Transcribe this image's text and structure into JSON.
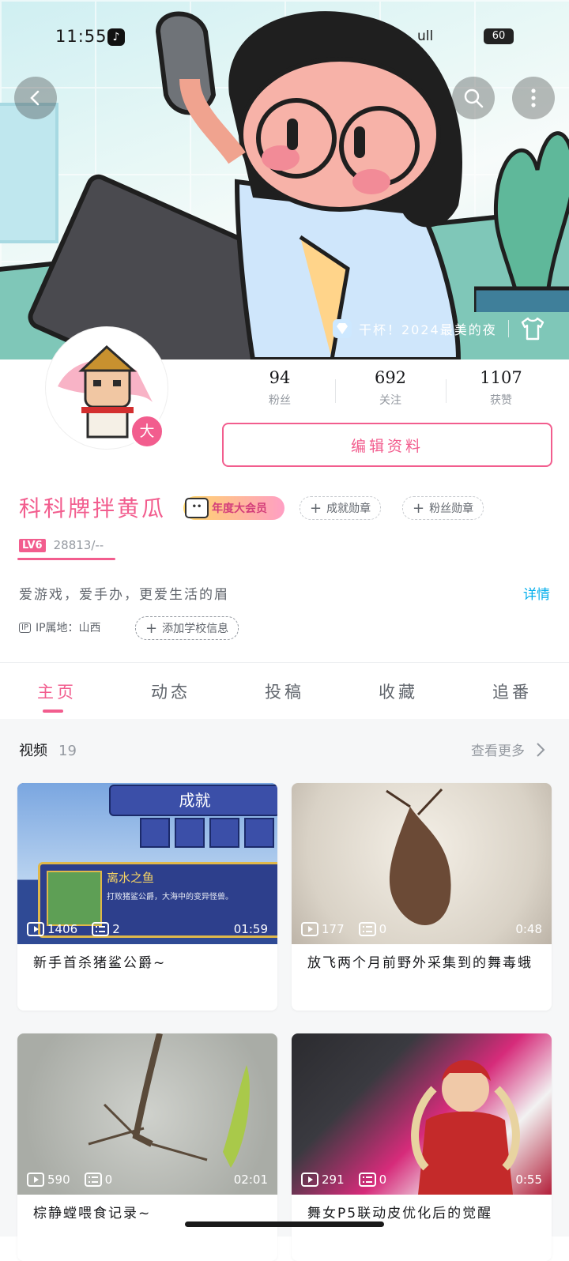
{
  "status_bar": {
    "time": "11:55",
    "signal": "ull",
    "battery": "60"
  },
  "banner": {
    "suit_label": "干杯！2024最美的夜"
  },
  "profile": {
    "avatar_badge": "大",
    "stats": [
      {
        "value": "94",
        "label": "粉丝"
      },
      {
        "value": "692",
        "label": "关注"
      },
      {
        "value": "1107",
        "label": "获赞"
      }
    ],
    "edit_label": "编辑资料",
    "name": "科科牌拌黄瓜",
    "vip_label": "年度大会员",
    "medal_achievement": "成就勋章",
    "medal_fans": "粉丝勋章",
    "level": "LV6",
    "exp": "28813/--",
    "bio": "爱游戏，爱手办，更爱生活的眉",
    "detail_label": "详情",
    "ip_icon_text": "IP",
    "ip_location": "IP属地：山西",
    "add_school": "添加学校信息"
  },
  "tabs": [
    "主页",
    "动态",
    "投稿",
    "收藏",
    "追番"
  ],
  "videos_section": {
    "title": "视频",
    "count": "19",
    "more_label": "查看更多",
    "items": [
      {
        "title": "新手首杀猪鲨公爵~",
        "plays": "1406",
        "comments": "2",
        "duration": "01:59",
        "thumb_text": {
          "header": "成就",
          "name": "离水之鱼",
          "desc": "打败猪鲨公爵，大海中的变异怪兽。"
        }
      },
      {
        "title": "放飞两个月前野外采集到的舞毒蛾",
        "plays": "177",
        "comments": "0",
        "duration": "0:48"
      },
      {
        "title": "棕静螳喂食记录~",
        "plays": "590",
        "comments": "0",
        "duration": "02:01"
      },
      {
        "title": "舞女P5联动皮优化后的觉醒",
        "plays": "291",
        "comments": "0",
        "duration": "0:55"
      }
    ]
  },
  "colors": {
    "accent": "#f25d8e",
    "link": "#00aeec",
    "muted": "#9499a0"
  }
}
